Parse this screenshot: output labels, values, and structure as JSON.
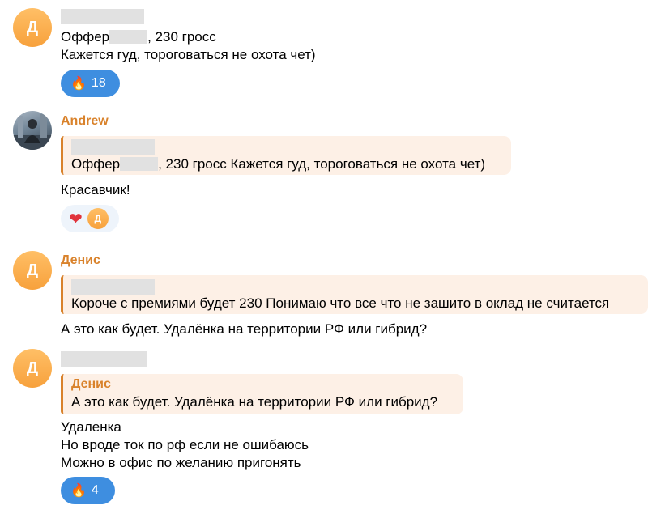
{
  "colors": {
    "accent": "#d9822b",
    "reaction_blue": "#3e8ee0",
    "quote_bg": "#fdf0e6",
    "redaction": "#e1e1e1"
  },
  "messages": [
    {
      "avatar_letter": "Д",
      "lines": [
        "Оффер",
        ", 230 гросс",
        "Кажется гуд, тороговаться не охота чет)"
      ],
      "reaction": {
        "icon": "fire-icon",
        "emoji": "🔥",
        "count": "18"
      }
    },
    {
      "author": "Andrew",
      "avatar_icon": "user-photo",
      "quote_part1": "Оффер",
      "quote_part2": ", 230 гросс Кажется гуд, тороговаться не охота чет)",
      "text": "Красавчик!",
      "reaction": {
        "icon": "heart-icon",
        "emoji": "❤",
        "avatar_letter": "Д"
      }
    },
    {
      "author": "Денис",
      "avatar_letter": "Д",
      "quote": "Короче с премиями будет 230  Понимаю что все что не зашито в оклад не считается",
      "text": "А это как будет. Удалёнка на территории РФ или гибрид?"
    },
    {
      "avatar_letter": "Д",
      "quote_author": "Денис",
      "quote": "А это как будет. Удалёнка на территории РФ или гибрид?",
      "lines": [
        "Удаленка",
        "Но вроде ток по рф если не ошибаюсь",
        "Можно в офис по желанию пригонять"
      ],
      "reaction": {
        "icon": "fire-icon",
        "emoji": "🔥",
        "count": "4"
      }
    }
  ]
}
